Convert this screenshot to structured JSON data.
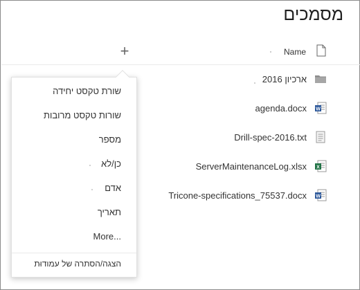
{
  "page": {
    "title": "מסמכים"
  },
  "header": {
    "add_column_symbol": "+",
    "name_column_label": "Name"
  },
  "files": [
    {
      "name": "ארכיון 2016",
      "type": "folder-icon"
    },
    {
      "name": "agenda.docx",
      "type": "word-icon"
    },
    {
      "name": "Drill-spec-2016.txt",
      "type": "text-file-icon"
    },
    {
      "name": "ServerMaintenanceLog.xlsx",
      "type": "excel-icon"
    },
    {
      "name": "Tricone-specifications_75537.docx",
      "type": "word-icon"
    }
  ],
  "column_menu": {
    "items": [
      {
        "label": "שורת טקסט יחידה"
      },
      {
        "label": "שורות טקסט מרובות"
      },
      {
        "label": "מספר"
      },
      {
        "label": "כן/לא"
      },
      {
        "label": "אדם"
      },
      {
        "label": "תאריך"
      },
      {
        "label": "More..."
      }
    ],
    "footer_label": "הצגה/הסתרה של עמודות"
  },
  "colors": {
    "word": "#2b579a",
    "excel": "#217346",
    "folder": "#8c8c8c",
    "border": "#8a8a8a"
  }
}
